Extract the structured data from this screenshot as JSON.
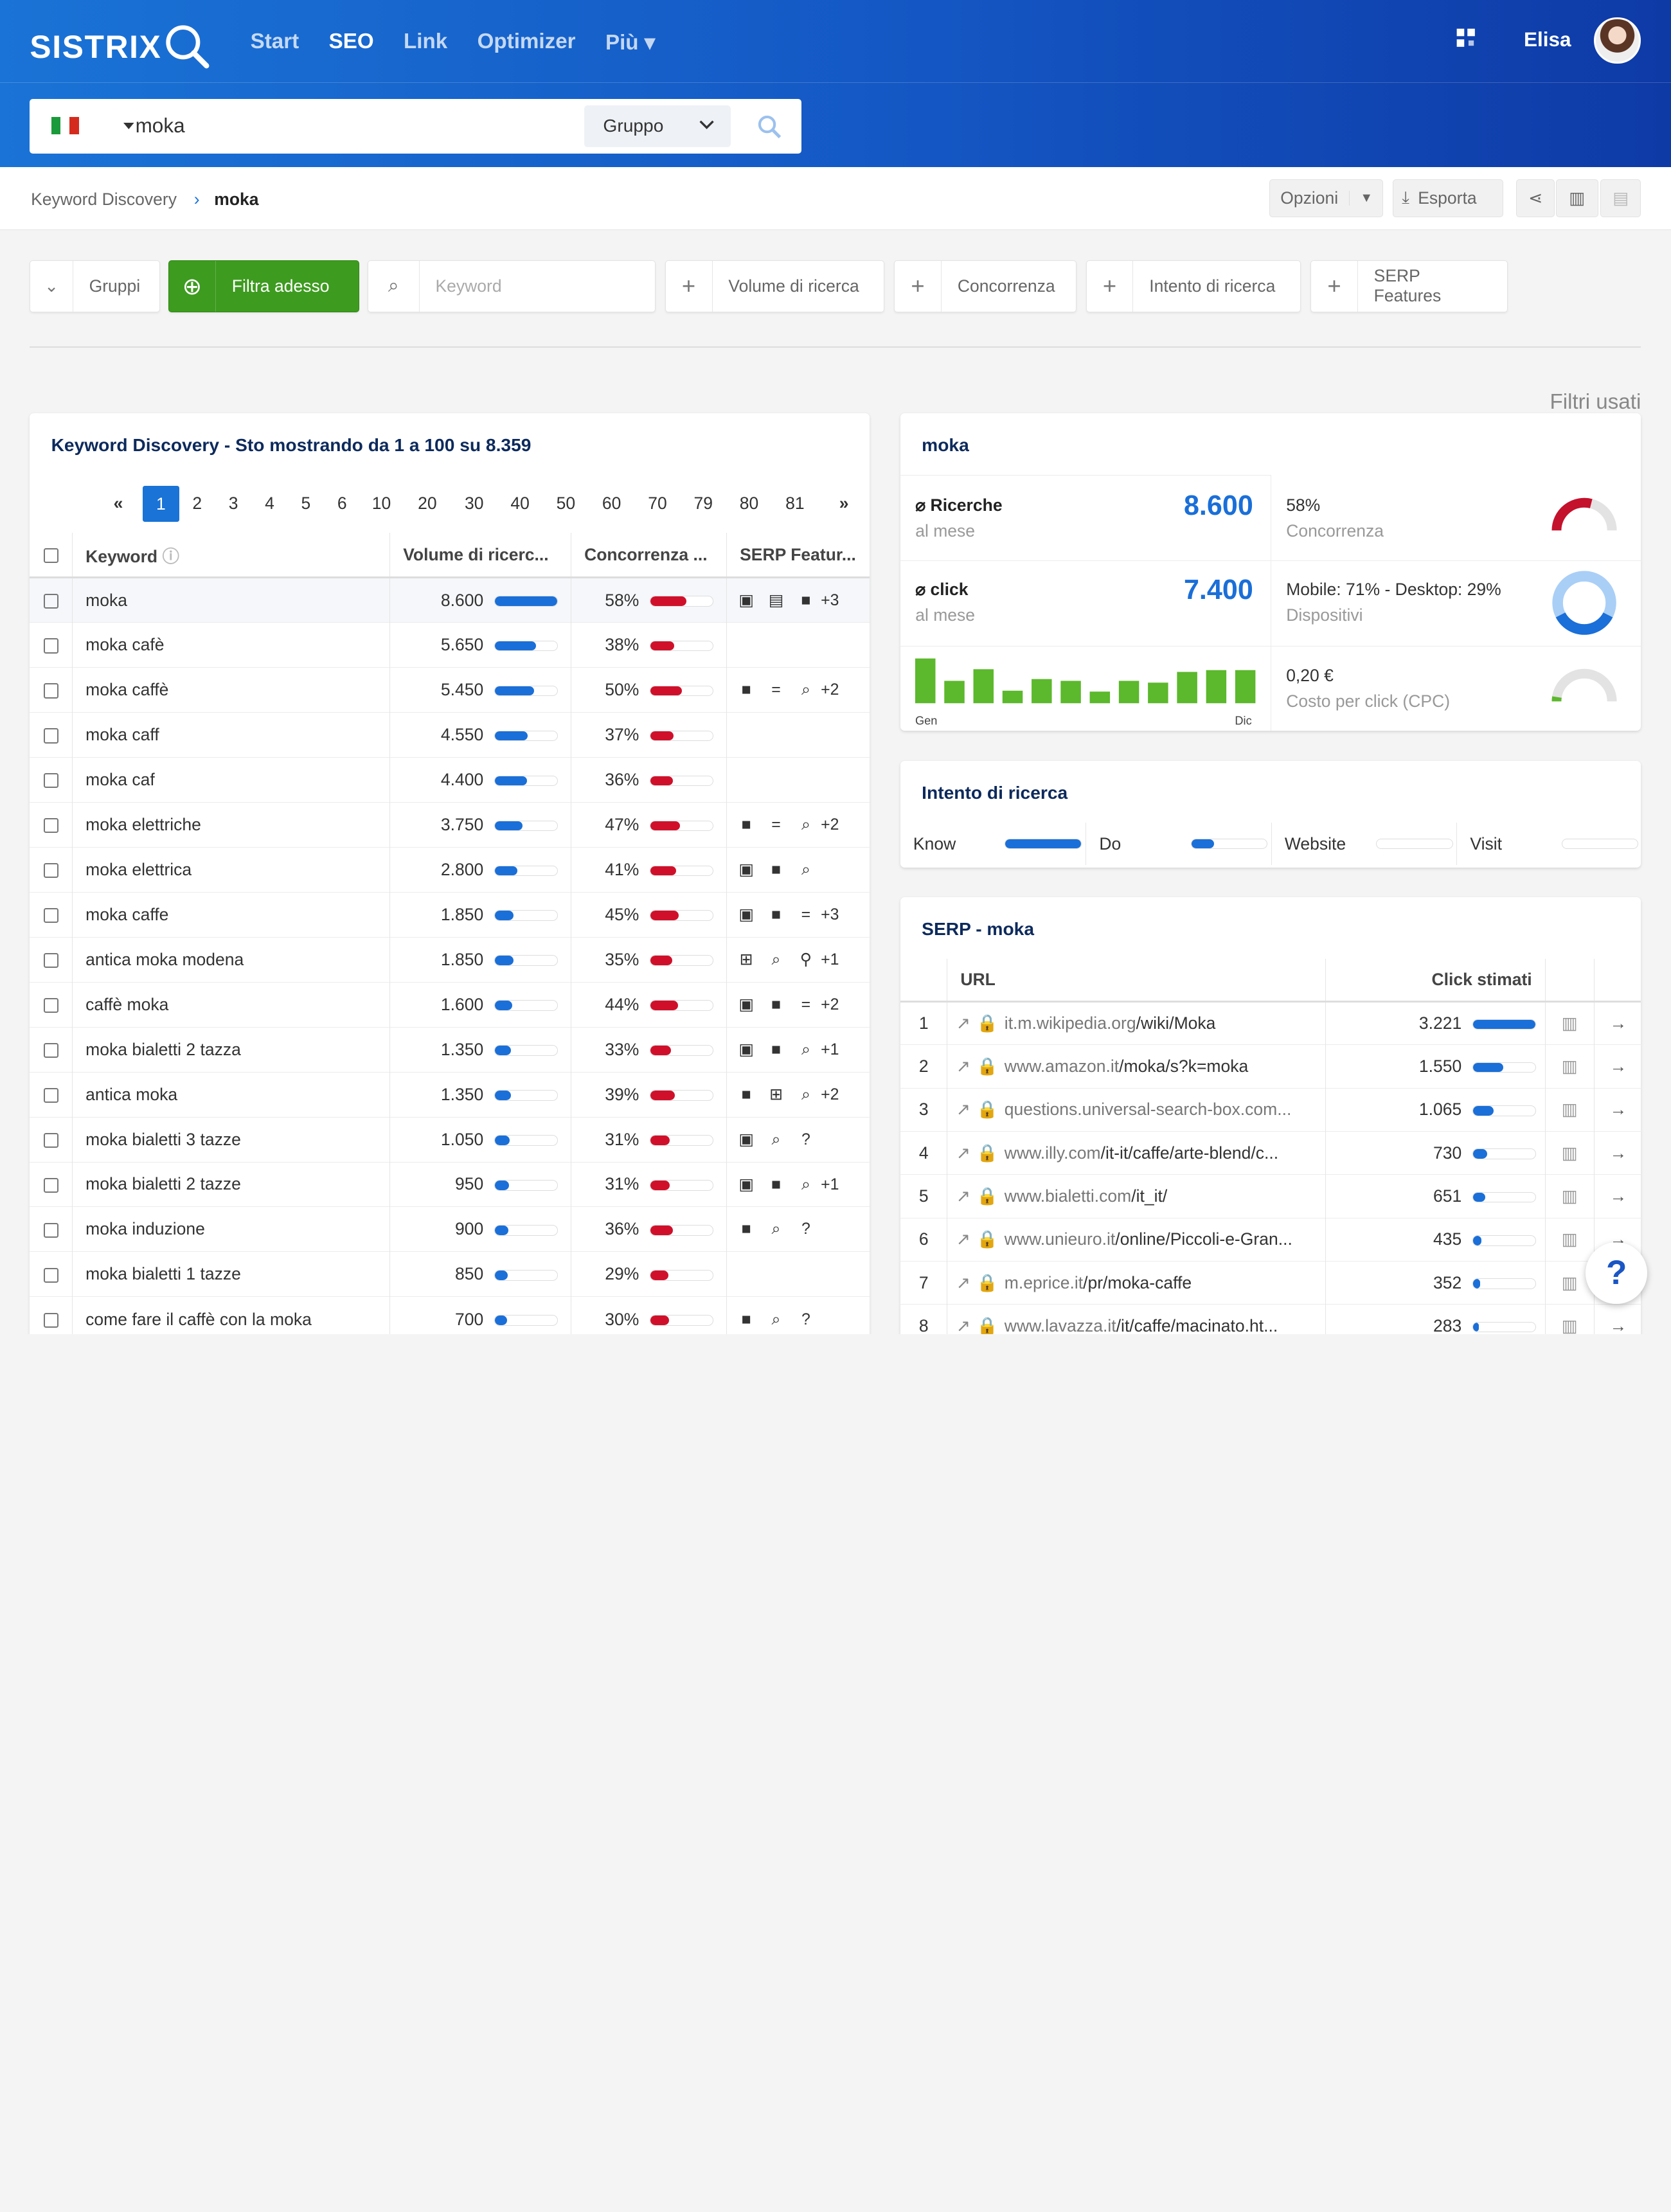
{
  "header": {
    "logo": "SISTRIX",
    "nav": [
      "Start",
      "SEO",
      "Link",
      "Optimizer",
      "Più"
    ],
    "active_nav": "SEO",
    "user": "Elisa"
  },
  "search": {
    "query": "moka",
    "group": "Gruppo",
    "country": "IT"
  },
  "breadcrumb": {
    "parent": "Keyword Discovery",
    "current": "moka"
  },
  "toolbar": {
    "options": "Opzioni",
    "export": "Esporta"
  },
  "filters": {
    "groups": "Gruppi",
    "filter_now": "Filtra adesso",
    "keyword_placeholder": "Keyword",
    "volume": "Volume di ricerca",
    "competition": "Concorrenza",
    "intent": "Intento di ricerca",
    "serp": "SERP Features",
    "used": "Filtri usati"
  },
  "table": {
    "title": "Keyword Discovery - Sto mostrando da 1 a 100 su 8.359",
    "pages": [
      "«",
      "1",
      "2",
      "3",
      "4",
      "5",
      "6",
      "10",
      "20",
      "30",
      "40",
      "50",
      "60",
      "70",
      "79",
      "80",
      "81",
      "»"
    ],
    "headers": [
      "Keyword",
      "Volume di ricerc...",
      "Concorrenza ...",
      "SERP Featur..."
    ],
    "rows": [
      {
        "kw": "moka",
        "vol": "8.600",
        "volp": 1.0,
        "comp": "58%",
        "compp": 0.58,
        "sf": [
          "img",
          "news",
          "vid"
        ],
        "more": "+3"
      },
      {
        "kw": "moka cafè",
        "vol": "5.650",
        "volp": 0.66,
        "comp": "38%",
        "compp": 0.38,
        "sf": [],
        "more": ""
      },
      {
        "kw": "moka caffè",
        "vol": "5.450",
        "volp": 0.63,
        "comp": "50%",
        "compp": 0.5,
        "sf": [
          "vid",
          "eq",
          "srch"
        ],
        "more": "+2"
      },
      {
        "kw": "moka caff",
        "vol": "4.550",
        "volp": 0.53,
        "comp": "37%",
        "compp": 0.37,
        "sf": [],
        "more": ""
      },
      {
        "kw": "moka caf",
        "vol": "4.400",
        "volp": 0.51,
        "comp": "36%",
        "compp": 0.36,
        "sf": [],
        "more": ""
      },
      {
        "kw": "moka elettriche",
        "vol": "3.750",
        "volp": 0.44,
        "comp": "47%",
        "compp": 0.47,
        "sf": [
          "vid",
          "eq",
          "srch"
        ],
        "more": "+2"
      },
      {
        "kw": "moka elettrica",
        "vol": "2.800",
        "volp": 0.36,
        "comp": "41%",
        "compp": 0.41,
        "sf": [
          "img",
          "vid",
          "srch"
        ],
        "more": ""
      },
      {
        "kw": "moka caffe",
        "vol": "1.850",
        "volp": 0.3,
        "comp": "45%",
        "compp": 0.45,
        "sf": [
          "img",
          "vid",
          "eq"
        ],
        "more": "+3"
      },
      {
        "kw": "antica moka modena",
        "vol": "1.850",
        "volp": 0.3,
        "comp": "35%",
        "compp": 0.35,
        "sf": [
          "grid",
          "srch",
          "pin"
        ],
        "more": "+1"
      },
      {
        "kw": "caffè moka",
        "vol": "1.600",
        "volp": 0.28,
        "comp": "44%",
        "compp": 0.44,
        "sf": [
          "img",
          "vid",
          "eq"
        ],
        "more": "+2"
      },
      {
        "kw": "moka bialetti 2 tazza",
        "vol": "1.350",
        "volp": 0.26,
        "comp": "33%",
        "compp": 0.33,
        "sf": [
          "img",
          "vid",
          "srch"
        ],
        "more": "+1"
      },
      {
        "kw": "antica moka",
        "vol": "1.350",
        "volp": 0.26,
        "comp": "39%",
        "compp": 0.39,
        "sf": [
          "vid",
          "grid",
          "srch"
        ],
        "more": "+2"
      },
      {
        "kw": "moka bialetti 3 tazze",
        "vol": "1.050",
        "volp": 0.24,
        "comp": "31%",
        "compp": 0.31,
        "sf": [
          "img",
          "srch",
          "q"
        ],
        "more": ""
      },
      {
        "kw": "moka bialetti 2 tazze",
        "vol": "950",
        "volp": 0.23,
        "comp": "31%",
        "compp": 0.31,
        "sf": [
          "img",
          "vid",
          "srch"
        ],
        "more": "+1"
      },
      {
        "kw": "moka induzione",
        "vol": "900",
        "volp": 0.22,
        "comp": "36%",
        "compp": 0.36,
        "sf": [
          "vid",
          "srch",
          "q"
        ],
        "more": ""
      },
      {
        "kw": "moka bialetti 1 tazze",
        "vol": "850",
        "volp": 0.21,
        "comp": "29%",
        "compp": 0.29,
        "sf": [],
        "more": ""
      },
      {
        "kw": "come fare il caffè con la moka",
        "vol": "700",
        "volp": 0.2,
        "comp": "30%",
        "compp": 0.3,
        "sf": [
          "vid",
          "srch",
          "q"
        ],
        "more": ""
      }
    ]
  },
  "overview": {
    "title": "moka",
    "searches_label": "Ricerche",
    "searches_sub": "al mese",
    "searches": "8.600",
    "clicks_label": "click",
    "clicks_sub": "al mese",
    "clicks": "7.400",
    "competition_value": "58%",
    "competition_label": "Concorrenza",
    "competition": 0.58,
    "devices_value": "Mobile: 71% - Desktop: 29%",
    "devices_label": "Dispositivi",
    "mobile": 0.71,
    "cpc_value": "0,20 €",
    "cpc_label": "Costo per click (CPC)",
    "cpc": 0.05,
    "months_first": "Gen",
    "months_last": "Dic",
    "monthly": [
      1.0,
      0.5,
      0.76,
      0.28,
      0.54,
      0.5,
      0.26,
      0.5,
      0.46,
      0.7,
      0.74,
      0.74
    ]
  },
  "intent": {
    "title": "Intento di ricerca",
    "items": [
      {
        "label": "Know",
        "value": 1.0
      },
      {
        "label": "Do",
        "value": 0.3
      },
      {
        "label": "Website",
        "value": 0.0
      },
      {
        "label": "Visit",
        "value": 0.0
      }
    ]
  },
  "serp": {
    "title": "SERP - moka",
    "headers": [
      "URL",
      "Click stimati"
    ],
    "rows": [
      {
        "pos": "1",
        "domain": "it.m.wikipedia.org",
        "path": "/wiki/Moka",
        "clicks": "3.221",
        "p": 1.0
      },
      {
        "pos": "2",
        "domain": "www.amazon.it",
        "path": "/moka/s?k=moka",
        "clicks": "1.550",
        "p": 0.48
      },
      {
        "pos": "3",
        "domain": "questions.universal-search-box.com...",
        "path": "",
        "clicks": "1.065",
        "p": 0.33
      },
      {
        "pos": "4",
        "domain": "www.illy.com",
        "path": "/it-it/caffe/arte-blend/c...",
        "clicks": "730",
        "p": 0.23
      },
      {
        "pos": "5",
        "domain": "www.bialetti.com",
        "path": "/it_it/",
        "clicks": "651",
        "p": 0.2
      },
      {
        "pos": "6",
        "domain": "www.unieuro.it",
        "path": "/online/Piccoli-e-Gran...",
        "clicks": "435",
        "p": 0.14
      },
      {
        "pos": "7",
        "domain": "m.eprice.it",
        "path": "/pr/moka-caffe",
        "clicks": "352",
        "p": 0.11
      },
      {
        "pos": "8",
        "domain": "www.lavazza.it",
        "path": "/it/caffe/macinato.ht...",
        "clicks": "283",
        "p": 0.09
      }
    ]
  }
}
